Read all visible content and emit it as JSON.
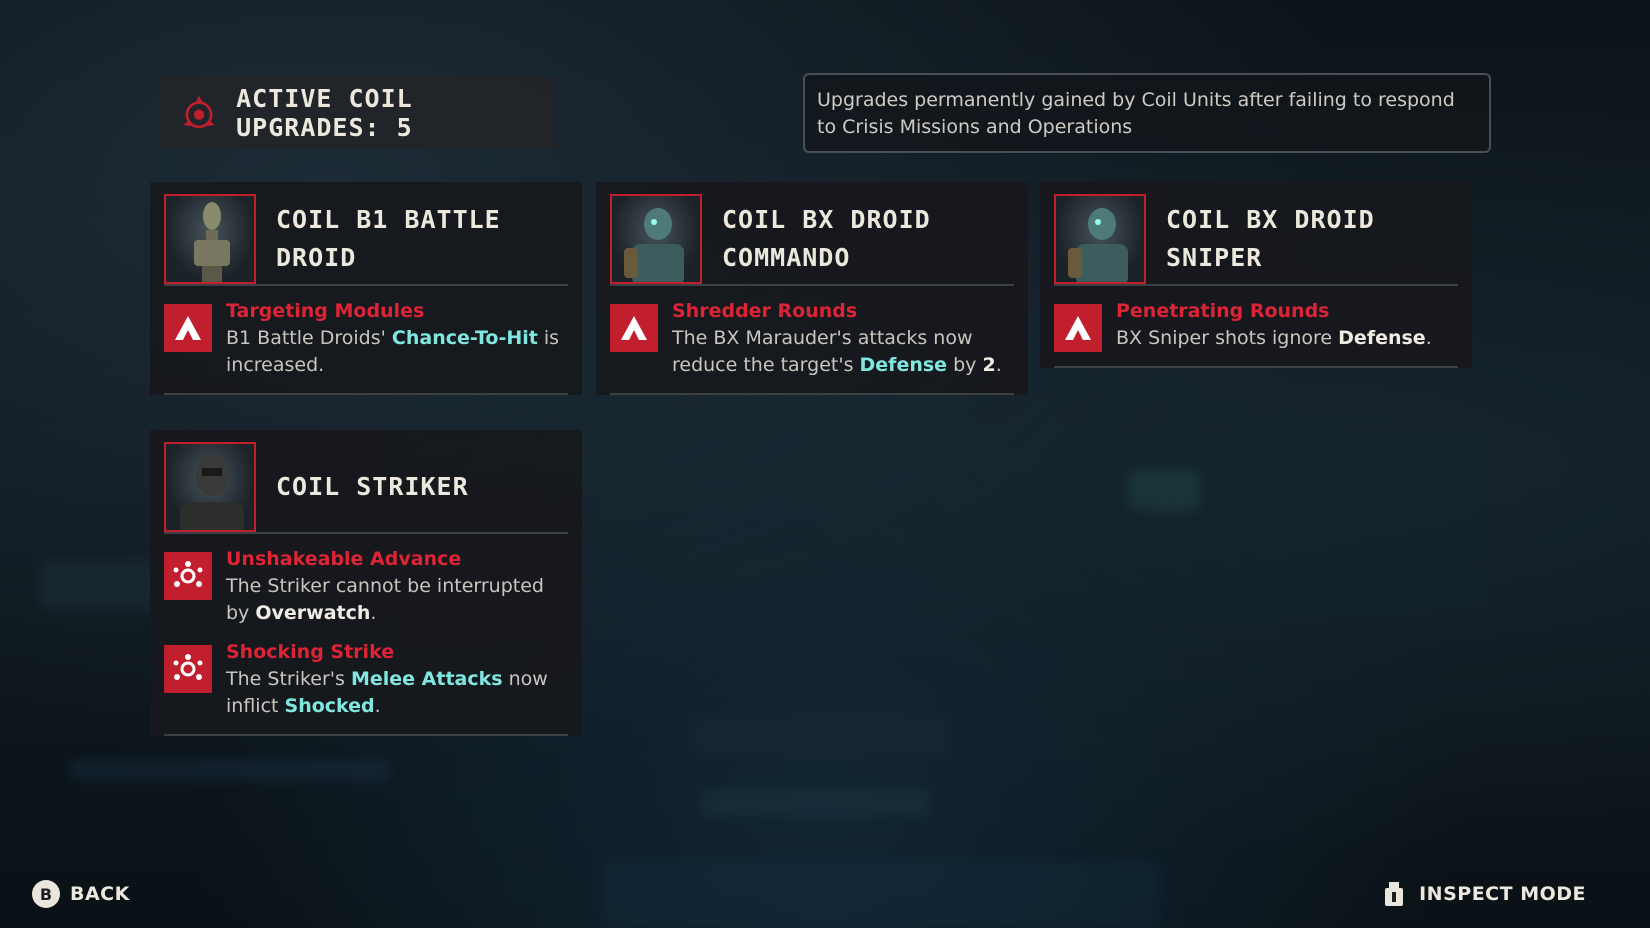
{
  "header": {
    "title": "ACTIVE COIL UPGRADES: 5"
  },
  "description": "Upgrades permanently gained by Coil Units after failing to respond to Crisis Missions and Operations",
  "cards": [
    {
      "title": "COIL B1 BATTLE DROID",
      "upgrades": [
        {
          "name": "Targeting Modules",
          "t1": "B1 Battle Droids' ",
          "h1": "Chance-To-Hit",
          "t2": " is increased."
        }
      ]
    },
    {
      "title": "COIL BX DROID COMMANDO",
      "upgrades": [
        {
          "name": "Shredder Rounds",
          "t1": "The BX Marauder's attacks now reduce the target's ",
          "h1": "Defense",
          "t2": " by ",
          "h2": "2",
          "t3": "."
        }
      ]
    },
    {
      "title": "COIL BX DROID SNIPER",
      "upgrades": [
        {
          "name": "Penetrating Rounds",
          "t1": "BX Sniper shots ignore ",
          "h1": "Defense",
          "t2": "."
        }
      ]
    },
    {
      "title": "COIL STRIKER",
      "upgrades": [
        {
          "name": "Unshakeable Advance",
          "t1": "The Striker cannot be interrupted by ",
          "h1": "Overwatch",
          "t2": "."
        },
        {
          "name": "Shocking Strike",
          "t1": "The Striker's ",
          "h1": "Melee Attacks",
          "t2": " now inflict ",
          "h2": "Shocked",
          "t3": "."
        }
      ]
    }
  ],
  "footer": {
    "back_key": "B",
    "back_label": "BACK",
    "inspect_label": "INSPECT MODE"
  },
  "colors": {
    "accent_red": "#c21f2e",
    "name_red": "#dd2435",
    "highlight_cyan": "#7fe7e0"
  },
  "icons": {
    "header": "coil-emblem-icon",
    "upgrade_a": "rank-chevron-icon",
    "upgrade_b": "shock-node-icon",
    "inspect": "inspect-mode-icon"
  }
}
